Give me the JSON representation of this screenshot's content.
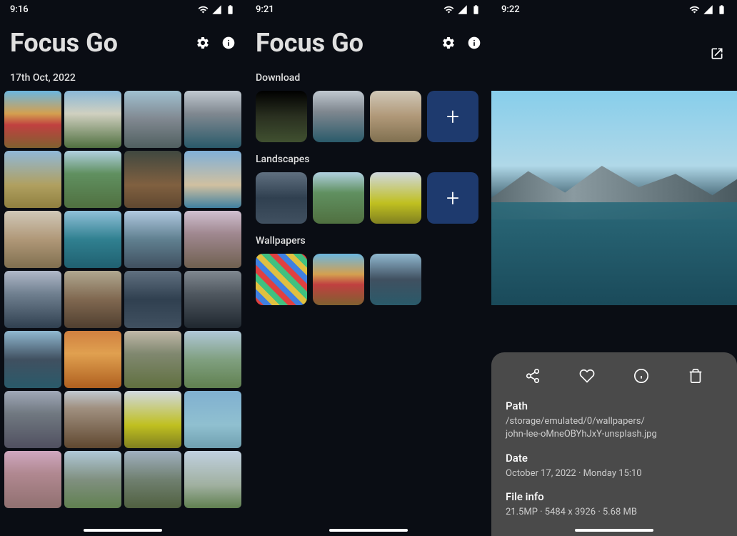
{
  "screens": {
    "grid": {
      "time": "9:16",
      "title": "Focus Go",
      "date_label": "17th Oct, 2022"
    },
    "folders": {
      "time": "9:21",
      "title": "Focus Go",
      "sections": [
        {
          "label": "Download"
        },
        {
          "label": "Landscapes"
        },
        {
          "label": "Wallpapers"
        }
      ],
      "add_glyph": "+"
    },
    "detail": {
      "time": "9:22",
      "info": {
        "path_label": "Path",
        "path_value_1": "/storage/emulated/0/wallpapers/",
        "path_value_2": "john-lee-oMneOBYhJxY-unsplash.jpg",
        "date_label": "Date",
        "date_value": "October 17, 2022 · Monday 15:10",
        "file_label": "File info",
        "file_value": "21.5MP · 5484 x 3926 · 5.68 MB"
      }
    }
  }
}
